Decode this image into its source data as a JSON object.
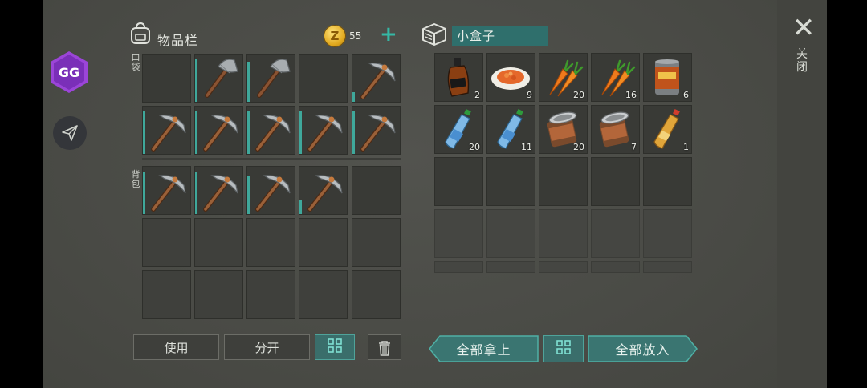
{
  "inventory": {
    "title": "物品栏",
    "coins": "55",
    "add_symbol": "+",
    "pocket_label": "口袋",
    "backpack_label": "背包",
    "pocket_slots": [
      {
        "item": "empty"
      },
      {
        "item": "axe",
        "durability": 0.9
      },
      {
        "item": "axe",
        "durability": 0.85
      },
      {
        "item": "empty"
      },
      {
        "item": "pickaxe",
        "durability": 0.2
      },
      {
        "item": "pickaxe",
        "durability": 0.9
      },
      {
        "item": "pickaxe",
        "durability": 0.9
      },
      {
        "item": "pickaxe",
        "durability": 0.9
      },
      {
        "item": "pickaxe",
        "durability": 0.9
      },
      {
        "item": "pickaxe",
        "durability": 0.9
      }
    ],
    "backpack_slots": [
      {
        "item": "pickaxe",
        "durability": 0.9
      },
      {
        "item": "pickaxe",
        "durability": 0.9
      },
      {
        "item": "pickaxe",
        "durability": 0.8
      },
      {
        "item": "pickaxe",
        "durability": 0.3
      },
      {
        "item": "empty"
      },
      {
        "item": "empty"
      },
      {
        "item": "empty"
      },
      {
        "item": "empty"
      },
      {
        "item": "empty"
      },
      {
        "item": "empty"
      },
      {
        "item": "empty"
      },
      {
        "item": "empty"
      },
      {
        "item": "empty"
      },
      {
        "item": "empty"
      },
      {
        "item": "empty"
      }
    ],
    "buttons": {
      "use": "使用",
      "split": "分开"
    }
  },
  "box": {
    "title": "小盒子",
    "slots": [
      {
        "item": "whiskey",
        "qty": "2"
      },
      {
        "item": "salad",
        "qty": "9"
      },
      {
        "item": "carrot",
        "qty": "20"
      },
      {
        "item": "carrot",
        "qty": "16"
      },
      {
        "item": "canned-food",
        "qty": "6"
      },
      {
        "item": "water-bottle",
        "qty": "20"
      },
      {
        "item": "water-bottle",
        "qty": "11"
      },
      {
        "item": "open-can",
        "qty": "20"
      },
      {
        "item": "open-can",
        "qty": "7"
      },
      {
        "item": "juice-bottle",
        "qty": "1"
      }
    ],
    "buttons": {
      "take_all": "全部拿上",
      "put_all": "全部放入"
    }
  },
  "close_label": "关闭",
  "close_symbol": "✕",
  "colors": {
    "accent": "#3fa89b",
    "title_bg": "#2f6f6c",
    "coin": "#e0a81e"
  }
}
